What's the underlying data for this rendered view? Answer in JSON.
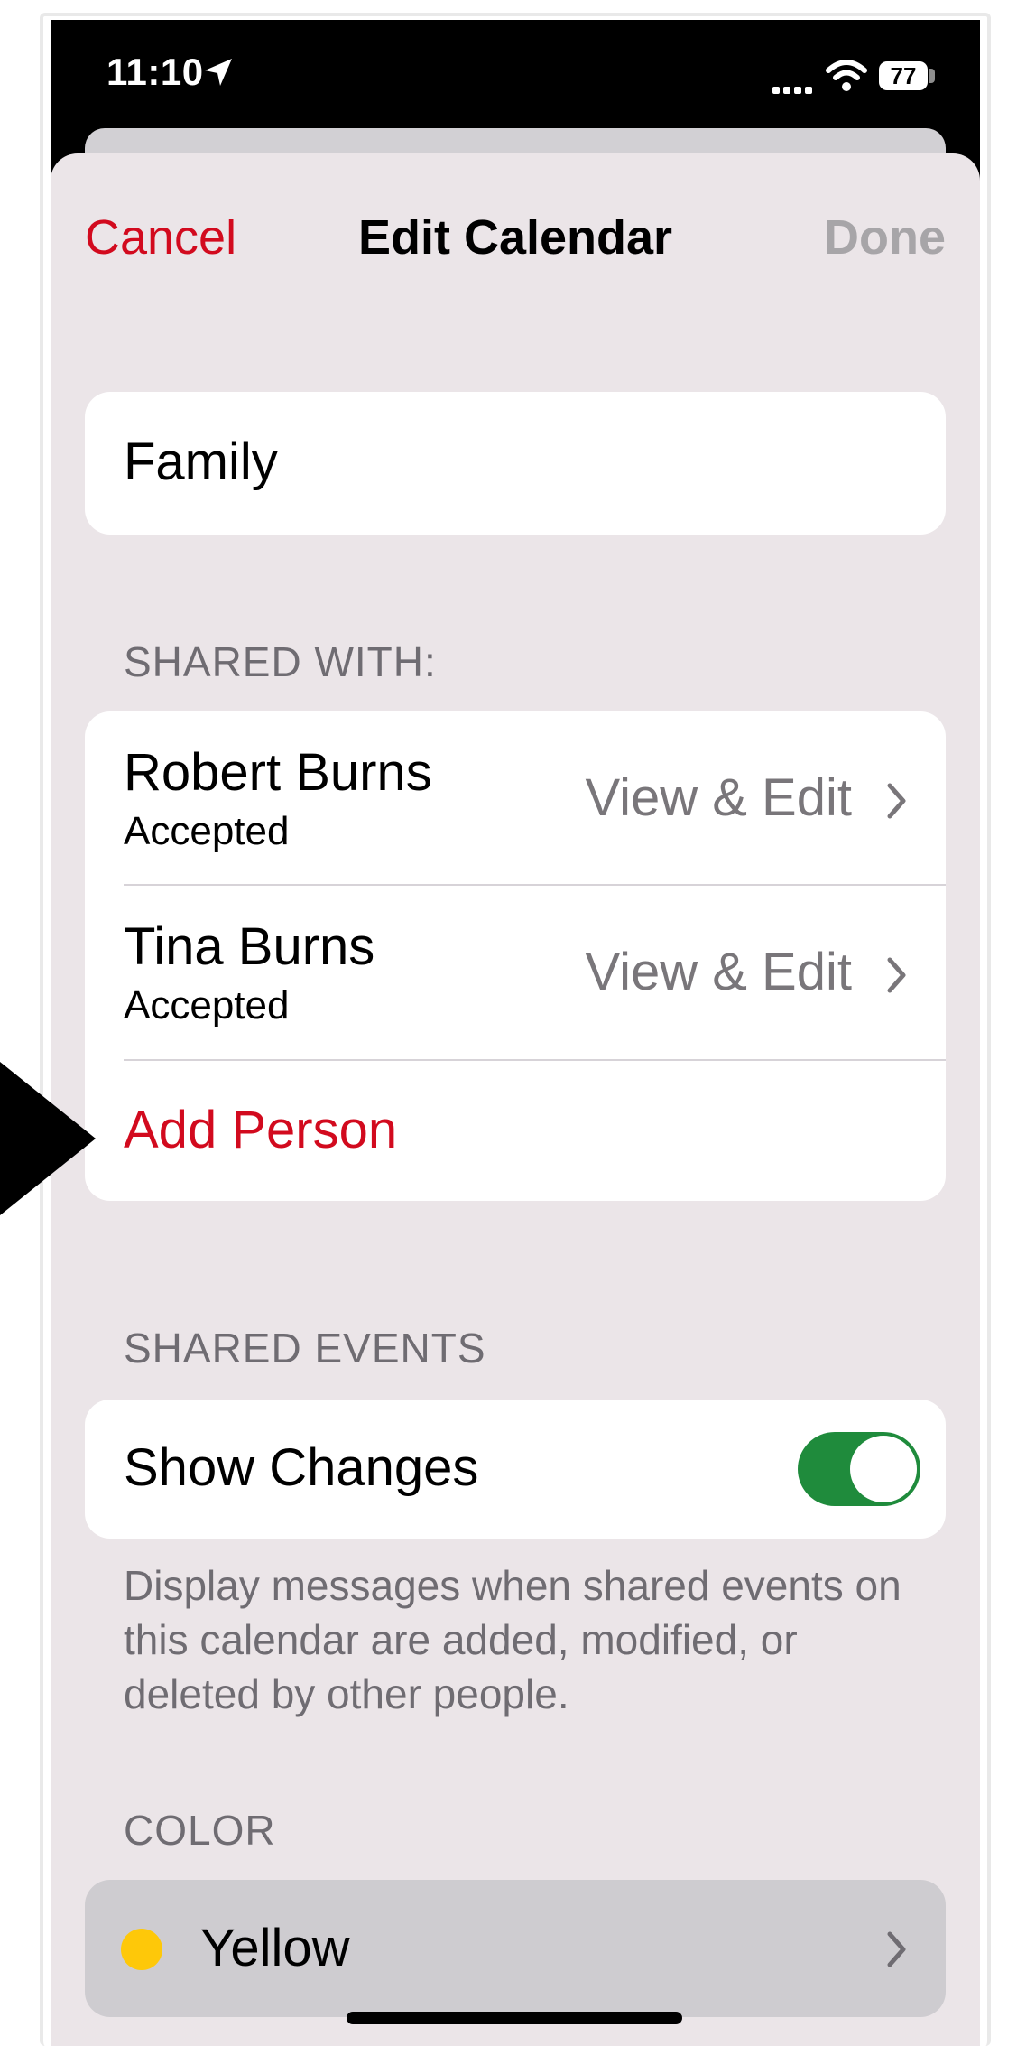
{
  "status_bar": {
    "time": "11:10",
    "battery": "77",
    "icons": [
      "location-arrow-icon",
      "cellular-signal-icon",
      "wifi-icon",
      "battery-icon"
    ]
  },
  "nav": {
    "cancel_label": "Cancel",
    "title": "Edit Calendar",
    "done_label": "Done"
  },
  "calendar_name": "Family",
  "shared_with": {
    "header": "SHARED WITH:",
    "people": [
      {
        "name": "Robert Burns",
        "status": "Accepted",
        "permission": "View & Edit"
      },
      {
        "name": "Tina Burns",
        "status": "Accepted",
        "permission": "View & Edit"
      }
    ],
    "add_person_label": "Add Person"
  },
  "shared_events": {
    "header": "SHARED EVENTS",
    "show_changes_label": "Show Changes",
    "show_changes_on": true,
    "footer": "Display messages when shared events on this calendar are added, modified, or deleted by other people."
  },
  "color": {
    "header": "COLOR",
    "selected": "Yellow",
    "swatch": "#FEC809"
  },
  "colors": {
    "accent_red": "#D20A1E",
    "toggle_green": "#1F8B3C",
    "background": "#EBE5E8"
  }
}
